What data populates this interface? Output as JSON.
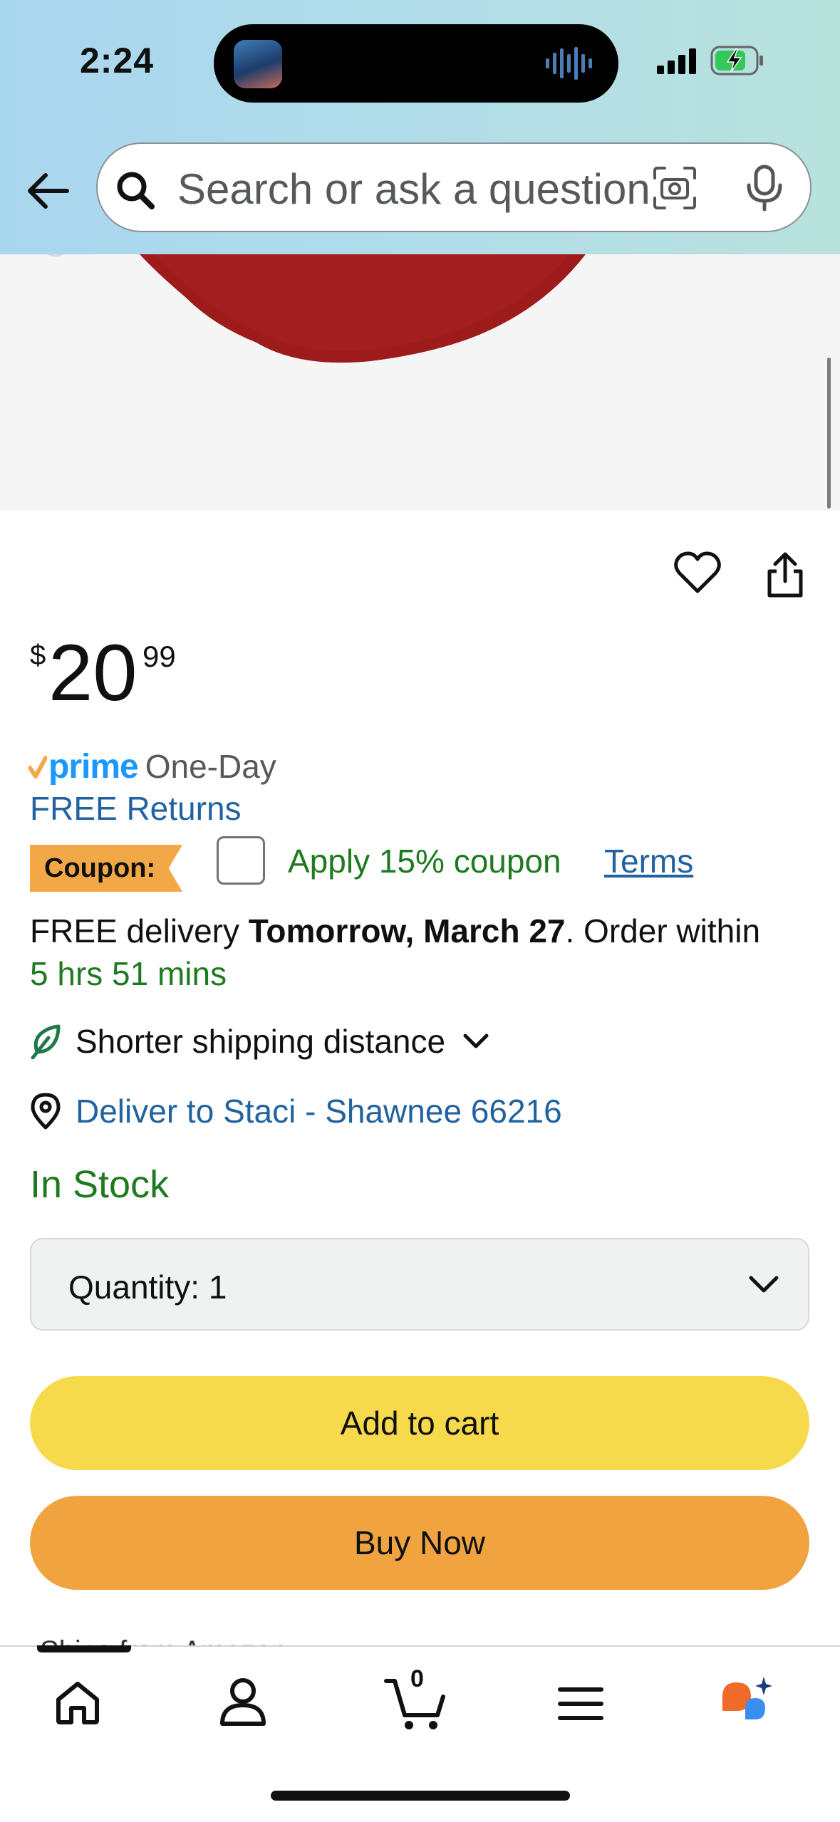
{
  "status_bar": {
    "time": "2:24"
  },
  "search": {
    "placeholder": "Search or ask a question"
  },
  "product": {
    "price": {
      "currency": "$",
      "whole": "20",
      "fraction": "99"
    },
    "prime": {
      "badge": "prime",
      "speed": "One-Day"
    },
    "free_returns": "FREE Returns",
    "coupon": {
      "badge": "Coupon:",
      "apply_label": "Apply 15% coupon",
      "terms_label": "Terms",
      "checked": false
    },
    "delivery": {
      "prefix": "FREE delivery ",
      "date": "Tomorrow, March 27",
      "suffix": ". Order within",
      "countdown": "5 hrs 51 mins"
    },
    "shipping": {
      "label": "Shorter shipping distance"
    },
    "deliver_to": "Deliver to Staci - Shawnee 66216",
    "stock": "In Stock",
    "quantity": {
      "label": "Quantity:",
      "value": "1"
    },
    "add_to_cart": "Add to cart",
    "buy_now": "Buy Now",
    "peek_text": "Ships from   Amazon"
  },
  "tabbar": {
    "cart_count": "0"
  },
  "colors": {
    "header_bg": "#b2dde8",
    "link": "#2162a1",
    "green": "#1f7a1f",
    "add_to_cart": "#f7d94c",
    "buy_now": "#f0a33f",
    "coupon_badge": "#f3a847",
    "prime_blue": "#1a98ff",
    "product_red": "#9e1b1b"
  },
  "icons": [
    "back-arrow-icon",
    "search-icon",
    "camera-icon",
    "mic-icon",
    "heart-icon",
    "share-icon",
    "leaf-icon",
    "chevron-down-icon",
    "location-pin-icon",
    "home-icon",
    "account-icon",
    "cart-icon",
    "menu-icon",
    "rufus-icon"
  ]
}
